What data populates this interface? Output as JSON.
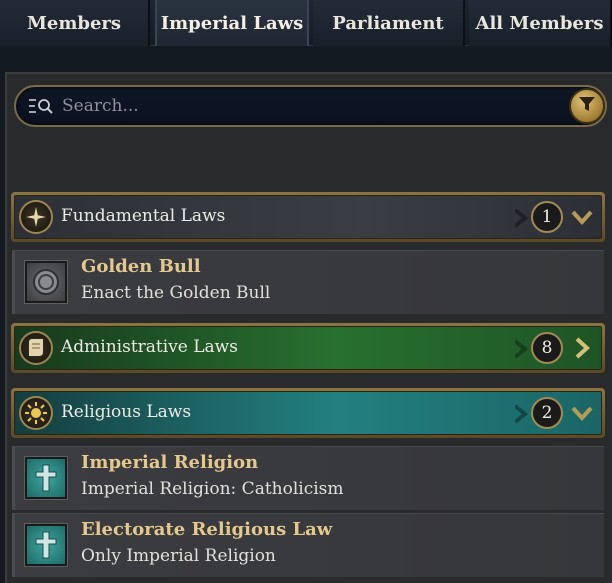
{
  "tabs": [
    {
      "label": "Members"
    },
    {
      "label": "Imperial Laws"
    },
    {
      "label": "Parliament"
    },
    {
      "label": "All Members"
    }
  ],
  "active_tab": "Imperial Laws",
  "search": {
    "placeholder": "Search...",
    "value": ""
  },
  "categories": [
    {
      "label": "Fundamental Laws",
      "count": "1",
      "expanded": true,
      "color": "#3a3d44",
      "items": [
        {
          "title": "Golden Bull",
          "subtitle": "Enact the Golden Bull",
          "icon": "golden-bull-icon"
        }
      ]
    },
    {
      "label": "Administrative Laws",
      "count": "8",
      "expanded": false,
      "color": "#28702f",
      "items": []
    },
    {
      "label": "Religious Laws",
      "count": "2",
      "expanded": true,
      "color": "#238080",
      "items": [
        {
          "title": "Imperial Religion",
          "subtitle": "Imperial Religion: Catholicism",
          "icon": "cross-icon"
        },
        {
          "title": "Electorate Religious Law",
          "subtitle": "Only Imperial Religion",
          "icon": "cross-icon"
        }
      ]
    }
  ],
  "colors": {
    "accent_gold": "#e4c98e",
    "frame_gold": "#8b7443",
    "background": "#141a22"
  }
}
